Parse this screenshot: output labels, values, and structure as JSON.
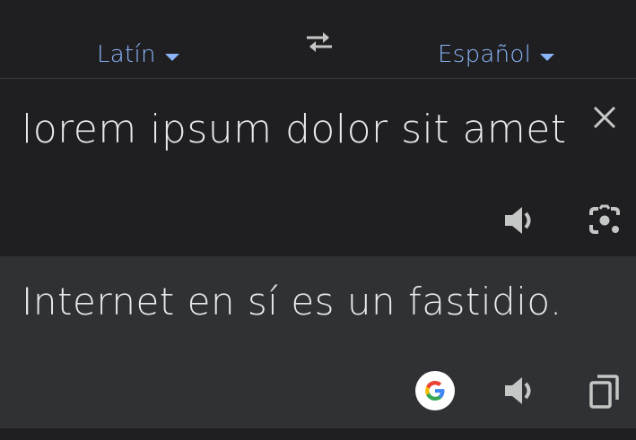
{
  "languages": {
    "source": "Latín",
    "target": "Español"
  },
  "source": {
    "text": "lorem ipsum dolor sit amet"
  },
  "translation": {
    "text": "Internet en sí es un fastidio."
  },
  "icons": {
    "swap": "swap-languages-icon",
    "dropdown": "caret-down-icon",
    "clear": "close-icon",
    "speaker": "speaker-icon",
    "camera": "camera-icon",
    "google": "google-logo-icon",
    "copy": "copy-icon"
  },
  "colors": {
    "accent": "#8ab4f8",
    "text": "#e8eaed",
    "icon": "#c4c7c5",
    "background": "#1f1f21",
    "result_background": "#303134"
  }
}
